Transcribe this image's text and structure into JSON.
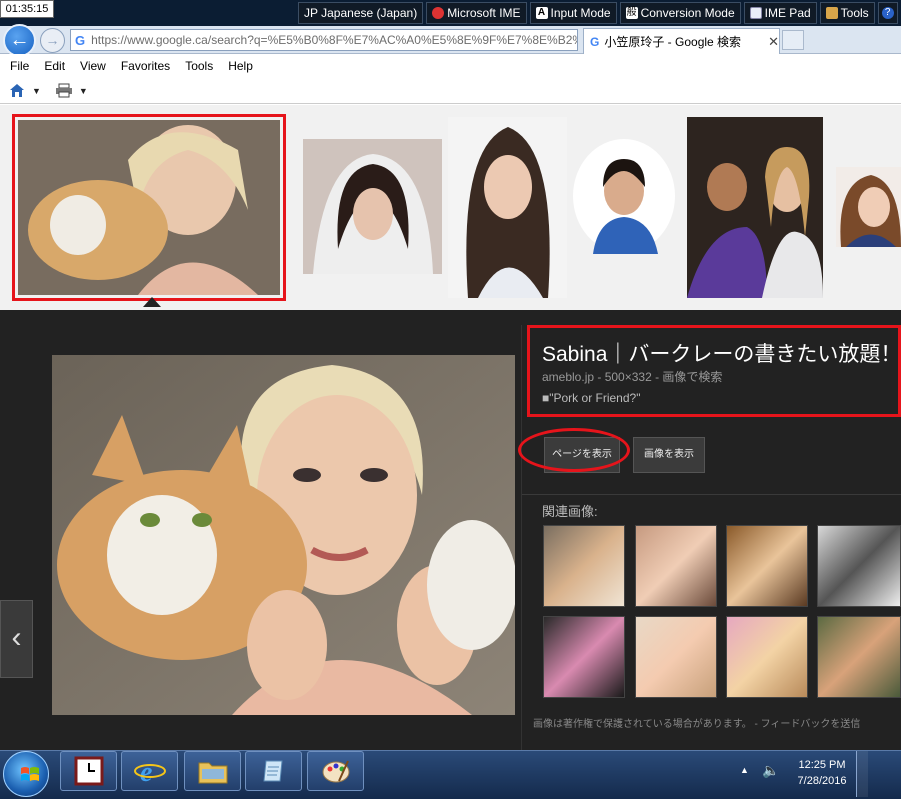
{
  "os": {
    "clock_top_left": "01:35:15",
    "ime": [
      {
        "icon": "ime-lang-icon",
        "label": "JP Japanese (Japan)"
      },
      {
        "icon": "microsoft-ime-icon",
        "label": "Microsoft IME"
      },
      {
        "icon": "input-mode-icon",
        "label": "Input Mode"
      },
      {
        "icon": "conversion-mode-icon",
        "label": "Conversion Mode"
      },
      {
        "icon": "ime-pad-icon",
        "label": "IME Pad"
      },
      {
        "icon": "tools-icon",
        "label": "Tools"
      }
    ],
    "ime_glyph_input": "A",
    "ime_glyph_conversion": "般"
  },
  "browser": {
    "url": "https://www.google.ca/search?q=%E5%B0%8F%E7%AC%A0%E5%8E%9F%E7%8E%B2%E5%AD",
    "url_icon": "G",
    "tab_title": "小笠原玲子 - Google 検索",
    "tab_close": "✕",
    "menu": [
      "File",
      "Edit",
      "View",
      "Favorites",
      "Tools",
      "Help"
    ]
  },
  "preview": {
    "title": "Sabina｜バークレーの書きたい放題！",
    "meta": "ameblo.jp - 500×332 - 画像で検索",
    "description": "■\"Pork or Friend?\"",
    "view_page_button": "ページを表示",
    "view_image_button": "画像を表示",
    "related_label": "関連画像:",
    "copyright": "画像は著作権で保護されている場合があります。 - フィードバックを送信",
    "prev_arrow": "‹"
  },
  "taskbar": {
    "time": "12:25 PM",
    "date": "7/28/2016"
  },
  "colors": {
    "highlight_red": "#e6141b",
    "panel_bg": "#222222",
    "taskbar": "#1c365f"
  }
}
